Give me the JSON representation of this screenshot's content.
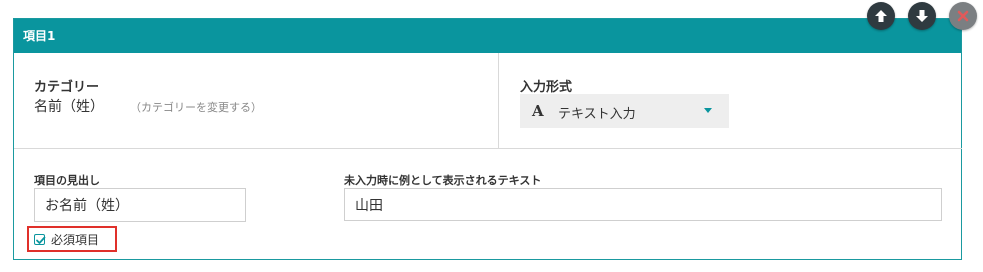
{
  "panel": {
    "title": "項目1",
    "accent_color": "#0a959e"
  },
  "controls": {
    "move_up_icon": "arrow-up-icon",
    "move_down_icon": "arrow-down-icon",
    "remove_icon": "close-icon"
  },
  "category": {
    "label": "カテゴリー",
    "value": "名前（姓）",
    "change_link": "（カテゴリーを変更する）"
  },
  "input_type": {
    "label": "入力形式",
    "icon": "A",
    "selected": "テキスト入力"
  },
  "heading": {
    "label": "項目の見出し",
    "value": "お名前（姓）"
  },
  "placeholder": {
    "label": "未入力時に例として表示されるテキスト",
    "value": "山田"
  },
  "required": {
    "label": "必須項目",
    "checked": true,
    "highlight_color": "#e0302a"
  }
}
